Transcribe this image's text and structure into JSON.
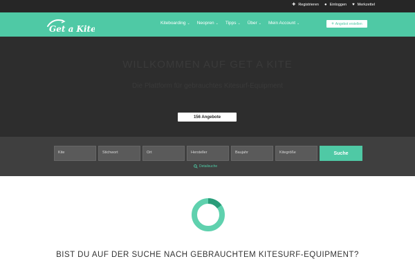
{
  "topbar": {
    "links": [
      {
        "icon": "plus-icon",
        "glyph": "✚",
        "label": "Registrieren"
      },
      {
        "icon": "user-icon",
        "glyph": "●",
        "label": "Einloggen"
      },
      {
        "icon": "heart-icon",
        "glyph": "♥",
        "label": "Merkzettel"
      }
    ]
  },
  "nav": {
    "logo_text": "Get a Kite",
    "items": [
      {
        "label": "Kiteboarding"
      },
      {
        "label": "Neopren"
      },
      {
        "label": "Tipps"
      },
      {
        "label": "Über"
      },
      {
        "label": "Mein Account"
      }
    ],
    "caret": "⌄",
    "cta_plus": "+",
    "cta_label": "Angebot erstellen"
  },
  "hero": {
    "title": "WILLKOMMEN AUF GET A KITE",
    "tagline": "Die Plattform für gebrauchtes Kitesurf-Equipment",
    "count_label": "156 Angebote"
  },
  "search": {
    "fields": [
      {
        "placeholder": "Kite"
      },
      {
        "placeholder": "Stichwort"
      },
      {
        "placeholder": "Ort"
      },
      {
        "placeholder": "Hersteller"
      },
      {
        "placeholder": "Baujahr"
      },
      {
        "placeholder": "Kitegröße"
      }
    ],
    "button_label": "Suche",
    "detail_icon": "search-icon",
    "detail_link": "Detailsuche"
  },
  "content": {
    "donut_fraction": 0.15,
    "headline": "BIST DU AUF DER SUCHE NACH GEBRAUCHTEM KITESURF-EQUIPMENT?"
  },
  "colors": {
    "accent": "#4fc9a5",
    "accent_dark": "#2a9d7a",
    "topbar": "#262626",
    "hero": "#2d2d2d",
    "search_bg": "#3f3f3f"
  }
}
